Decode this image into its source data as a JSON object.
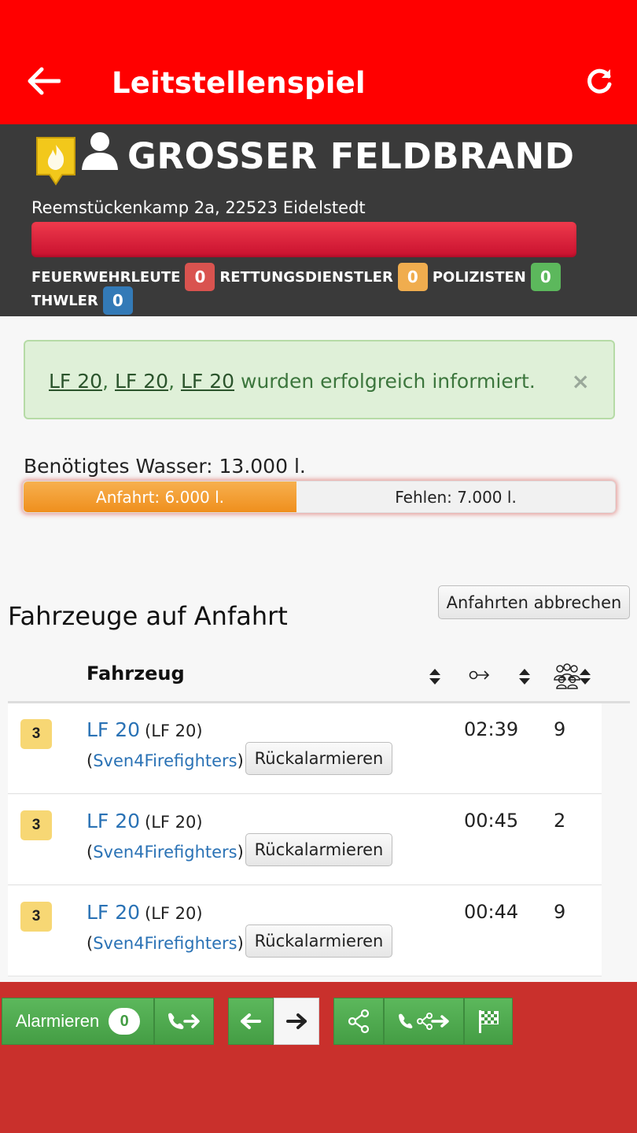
{
  "appbar": {
    "title": "Leitstellenspiel"
  },
  "mission": {
    "name": "GROSSER FELDBRAND",
    "address": "Reemstückenkamp 2a, 22523 Eidelstedt",
    "progress_pct": 100,
    "counts": [
      {
        "label": "FEUERWEHRLEUTE",
        "value": "0",
        "color": "#d9534f"
      },
      {
        "label": "RETTUNGSDIENSTLER",
        "value": "0",
        "color": "#f0ad4e"
      },
      {
        "label": "POLIZISTEN",
        "value": "0",
        "color": "#5cb85c"
      },
      {
        "label": "THWLER",
        "value": "0",
        "color": "#337ab7"
      }
    ]
  },
  "alert": {
    "links": [
      "LF 20",
      "LF 20",
      "LF 20"
    ],
    "separator": ", ",
    "text": " wurden erfolgreich informiert.",
    "close": "×"
  },
  "water": {
    "label": "Benötigtes Wasser: 13.000 l.",
    "arriving": "Anfahrt: 6.000 l.",
    "missing": "Fehlen: 7.000 l.",
    "arriving_liters": 6000,
    "required_liters": 13000
  },
  "section": {
    "title": "Fahrzeuge auf Anfahrt",
    "abort_label": "Anfahrten abbrechen",
    "col_vehicle": "Fahrzeug"
  },
  "vehicles": [
    {
      "level": "3",
      "name": "LF 20",
      "type": "(LF 20)",
      "owner": "Sven4Firefighters",
      "recall": "Rückalarmieren",
      "eta": "02:39",
      "crew": "9"
    },
    {
      "level": "3",
      "name": "LF 20",
      "type": "(LF 20)",
      "owner": "Sven4Firefighters",
      "recall": "Rückalarmieren",
      "eta": "00:45",
      "crew": "2"
    },
    {
      "level": "3",
      "name": "LF 20",
      "type": "(LF 20)",
      "owner": "Sven4Firefighters",
      "recall": "Rückalarmieren",
      "eta": "00:44",
      "crew": "9"
    }
  ],
  "bottombar": {
    "alarm_label": "Alarmieren",
    "alarm_count": "0"
  }
}
